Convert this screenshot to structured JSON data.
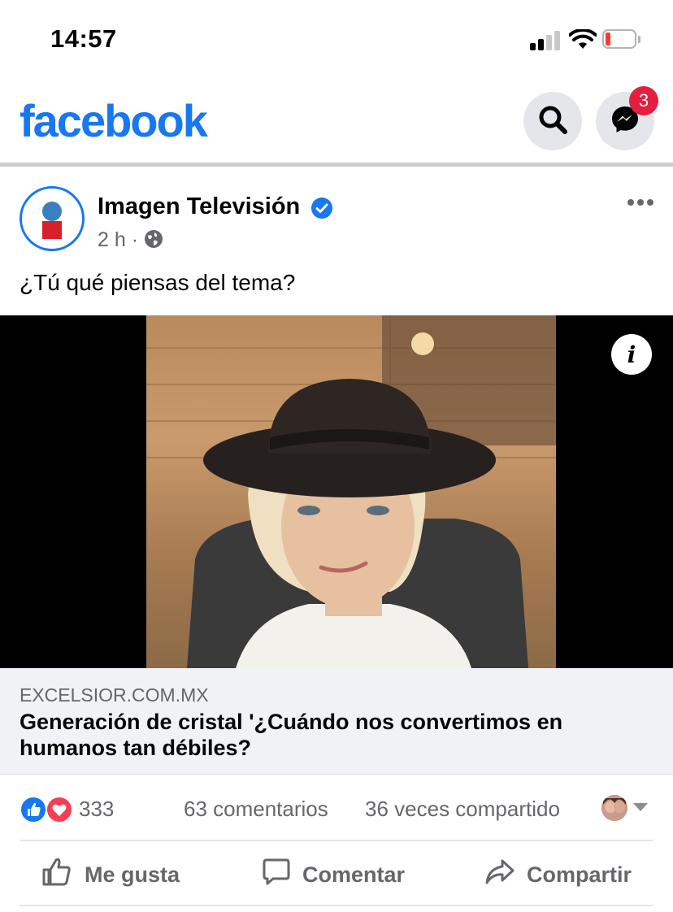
{
  "status_bar": {
    "time": "14:57"
  },
  "header": {
    "logo": "facebook",
    "messenger_badge": "3",
    "brand_color": "#1877f2"
  },
  "post": {
    "page_name": "Imagen Televisión",
    "time": "2 h",
    "separator": "·",
    "text": "¿Tú qué piensas del tema?",
    "media": {
      "info_symbol": "i"
    },
    "link": {
      "domain": "EXCELSIOR.COM.MX",
      "title": "Generación de cristal '¿Cuándo nos convertimos en humanos tan débiles?"
    },
    "stats": {
      "reactions": "333",
      "comments": "63 comentarios",
      "shares": "36 veces compartido"
    },
    "actions": {
      "like": "Me gusta",
      "comment": "Comentar",
      "share": "Compartir"
    }
  },
  "icons": [
    "search-icon",
    "messenger-icon",
    "globe-icon",
    "verified-icon",
    "more-icon",
    "info-icon",
    "like-icon",
    "comment-icon",
    "share-icon"
  ]
}
